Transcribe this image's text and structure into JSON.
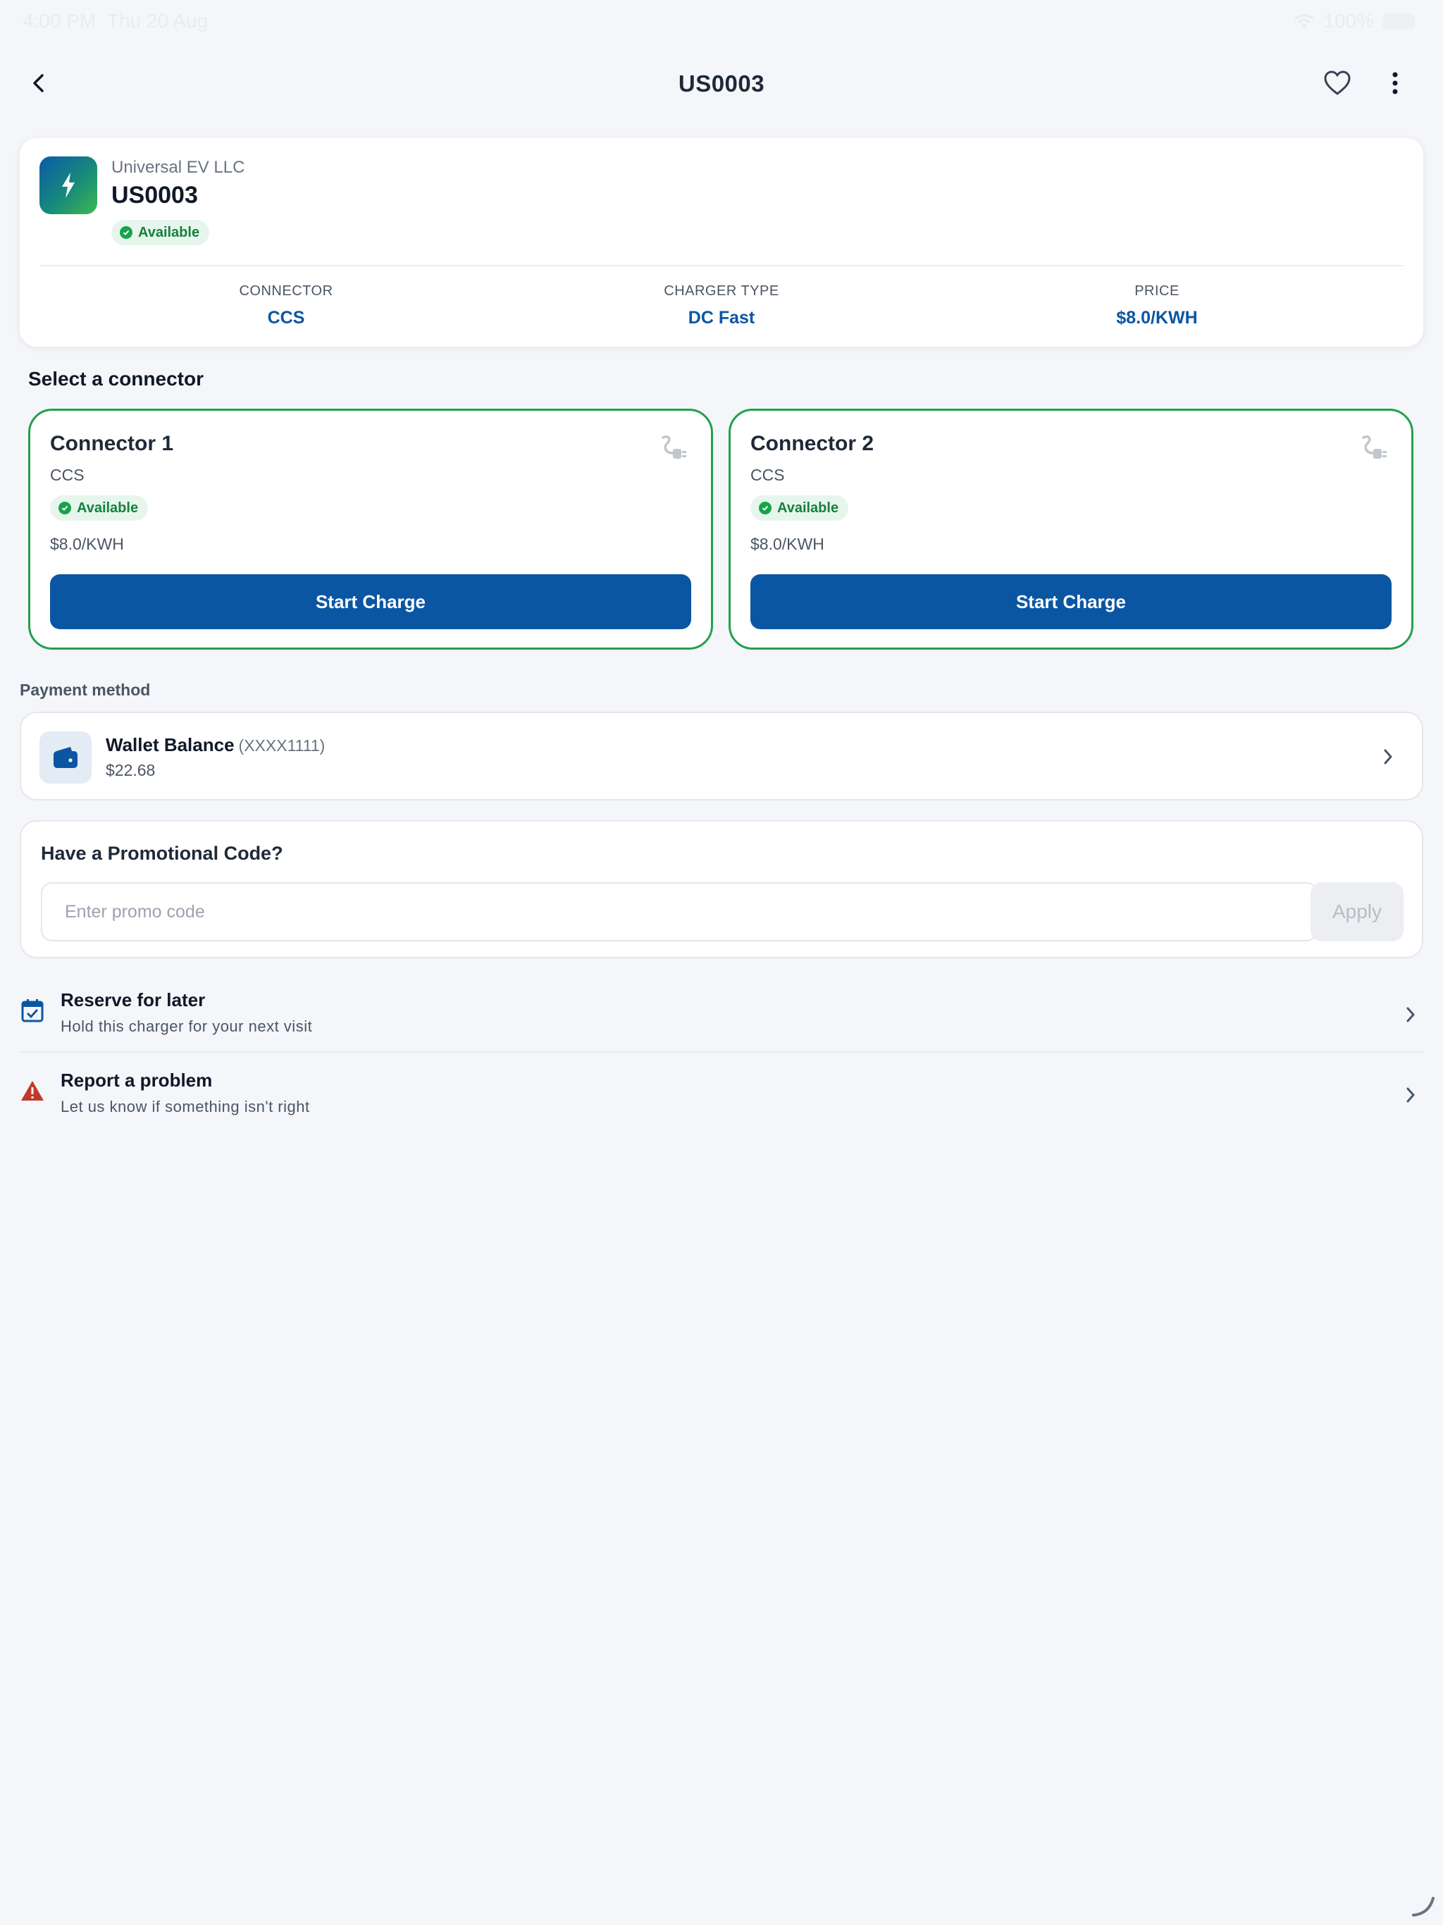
{
  "statusbar": {
    "time": "4:00 PM",
    "date": "Thu 20 Aug",
    "battery": "100%"
  },
  "header": {
    "title": "US0003"
  },
  "station": {
    "operator": "Universal EV LLC",
    "id": "US0003",
    "status": "Available",
    "stats": [
      {
        "label": "CONNECTOR",
        "value": "CCS"
      },
      {
        "label": "CHARGER TYPE",
        "value": "DC Fast"
      },
      {
        "label": "PRICE",
        "value": "$8.0/KWH"
      }
    ]
  },
  "connectors": {
    "section_title": "Select a connector",
    "items": [
      {
        "name": "Connector 1",
        "type": "CCS",
        "status": "Available",
        "price": "$8.0/KWH",
        "button": "Start Charge"
      },
      {
        "name": "Connector 2",
        "type": "CCS",
        "status": "Available",
        "price": "$8.0/KWH",
        "button": "Start Charge"
      }
    ]
  },
  "payment": {
    "label": "Payment method",
    "method": "Wallet Balance",
    "masked": "(XXXX1111)",
    "balance": "$22.68"
  },
  "promo": {
    "title": "Have a Promotional Code?",
    "placeholder": "Enter promo code",
    "value": "",
    "apply_label": "Apply"
  },
  "actions": [
    {
      "title": "Reserve for later",
      "subtitle": "Hold this charger for your next visit",
      "icon": "calendar-check-icon"
    },
    {
      "title": "Report a problem",
      "subtitle": "Let us know if something isn't right",
      "icon": "warning-icon"
    }
  ],
  "colors": {
    "accent": "#0b56a3",
    "available_green": "#22a04b",
    "warning_red": "#c0392b"
  }
}
